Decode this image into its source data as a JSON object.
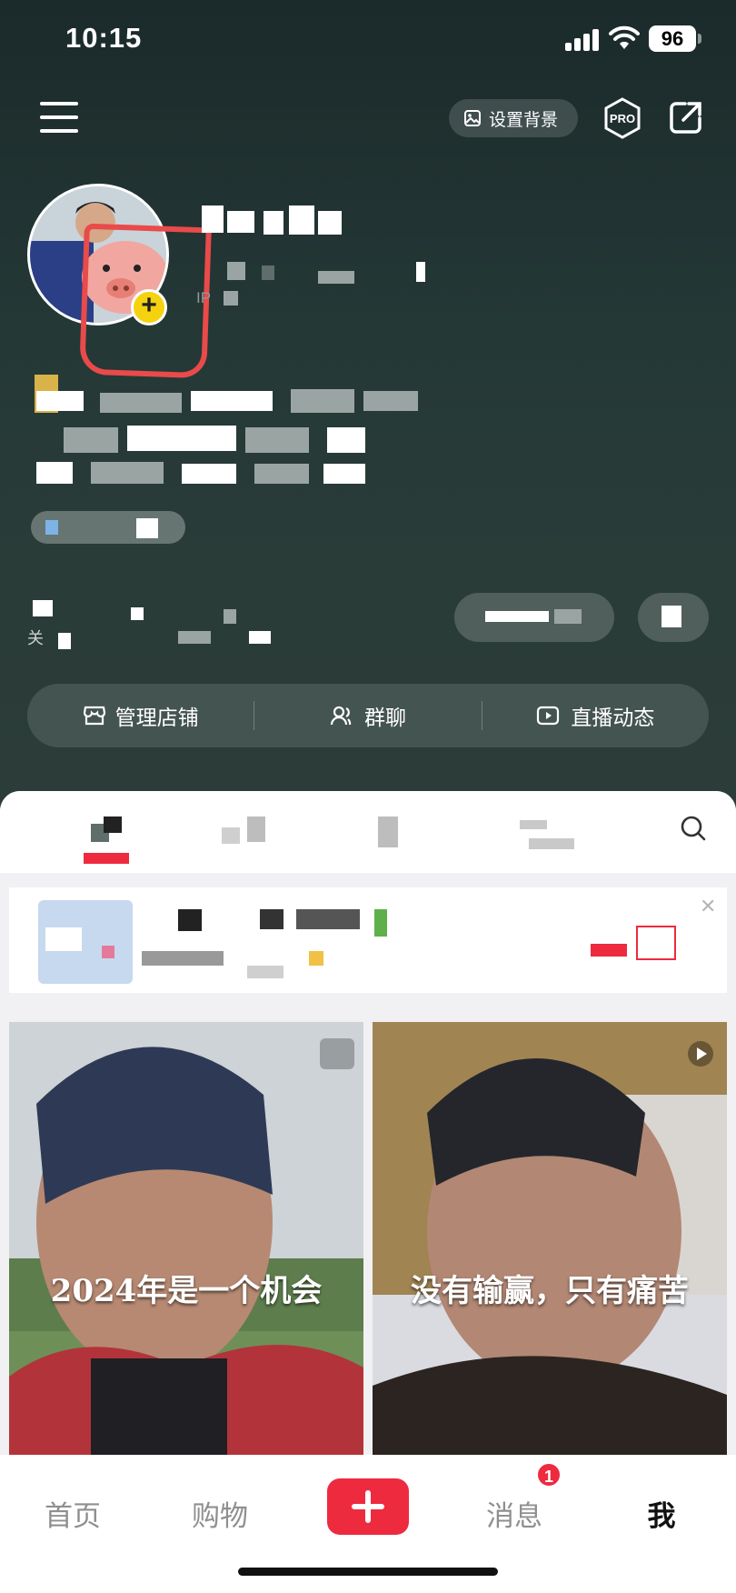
{
  "status_bar": {
    "time": "10:15",
    "battery": "96"
  },
  "top_nav": {
    "set_background_label": "设置背景",
    "pro_label": "PRO"
  },
  "profile": {
    "ip_prefix": "IP",
    "follow_prefix": "关"
  },
  "action_bar": {
    "items": [
      {
        "label": "管理店铺",
        "icon": "store-icon"
      },
      {
        "label": "群聊",
        "icon": "group-icon"
      },
      {
        "label": "直播动态",
        "icon": "live-icon"
      }
    ]
  },
  "videos": [
    {
      "caption": "2024年是一个机会"
    },
    {
      "caption": "没有输赢，只有痛苦"
    }
  ],
  "bottom_nav": {
    "items": [
      "首页",
      "购物",
      "消息",
      "我"
    ],
    "add_icon": "plus-icon",
    "message_badge": "1",
    "active": "我"
  },
  "colors": {
    "accent": "#ee2a3f",
    "avatar_add": "#f5d20f",
    "annotation": "#e94a4a"
  }
}
